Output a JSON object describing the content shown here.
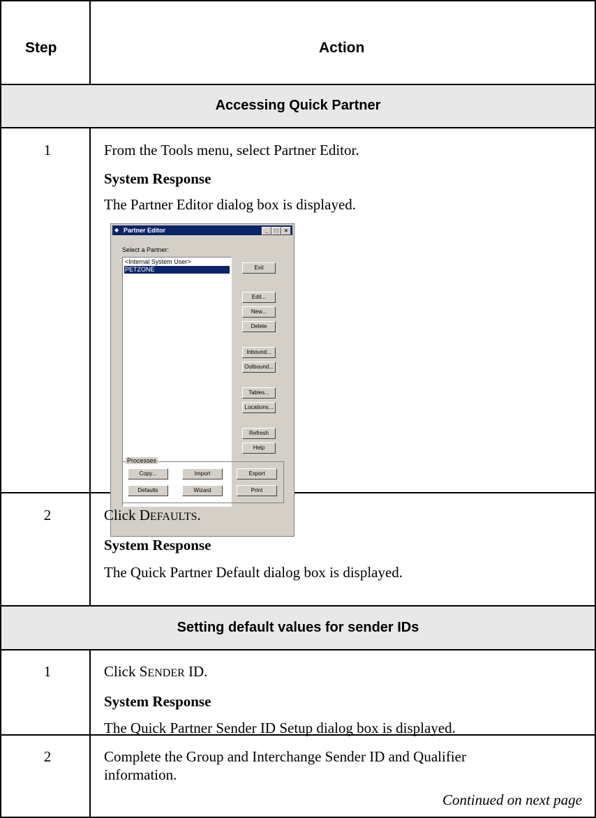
{
  "table": {
    "headers": {
      "step": "Step",
      "action": "Action"
    },
    "sections": [
      {
        "title": "Accessing Quick Partner",
        "steps": [
          {
            "number": "1",
            "instruction": "From the Tools menu, select Partner Editor.",
            "response_label": "System Response",
            "response": "The Partner Editor dialog box is displayed."
          },
          {
            "number": "2",
            "instruction_prefix": "Click ",
            "instruction_sc_initial": "D",
            "instruction_sc_rest": "EFAULTS",
            "instruction_suffix": ".",
            "response_label": "System Response",
            "response": "The Quick Partner Default dialog box is displayed."
          }
        ]
      },
      {
        "title": "Setting default values for sender IDs",
        "steps": [
          {
            "number": "1",
            "instruction_prefix": "Click ",
            "instruction_sc_initial": "S",
            "instruction_sc_rest": "ENDER",
            "instruction_suffix": " ID.",
            "response_label": "System Response",
            "response": "The Quick Partner Sender ID Setup dialog box is displayed."
          },
          {
            "number": "2",
            "instruction_line1": "Complete the Group and Interchange Sender ID and Qualifier",
            "instruction_line2": "information."
          }
        ]
      }
    ],
    "continued": "Continued on next page"
  },
  "dialog": {
    "title": "Partner Editor",
    "select_label": "Select a Partner:",
    "partners": [
      "<Internal System User>",
      "PETZONE"
    ],
    "selected_partner": "PETZONE",
    "side_buttons": [
      "Exit",
      "Edit...",
      "New...",
      "Delete",
      "Inbound...",
      "Outbound...",
      "Tables...",
      "Locations...",
      "Refresh",
      "Help"
    ],
    "processes_label": "Processes",
    "process_buttons": [
      "Copy...",
      "Import",
      "Export",
      "Defaults",
      "Wizard",
      "Print"
    ],
    "window_controls": [
      "_",
      "□",
      "×"
    ]
  }
}
